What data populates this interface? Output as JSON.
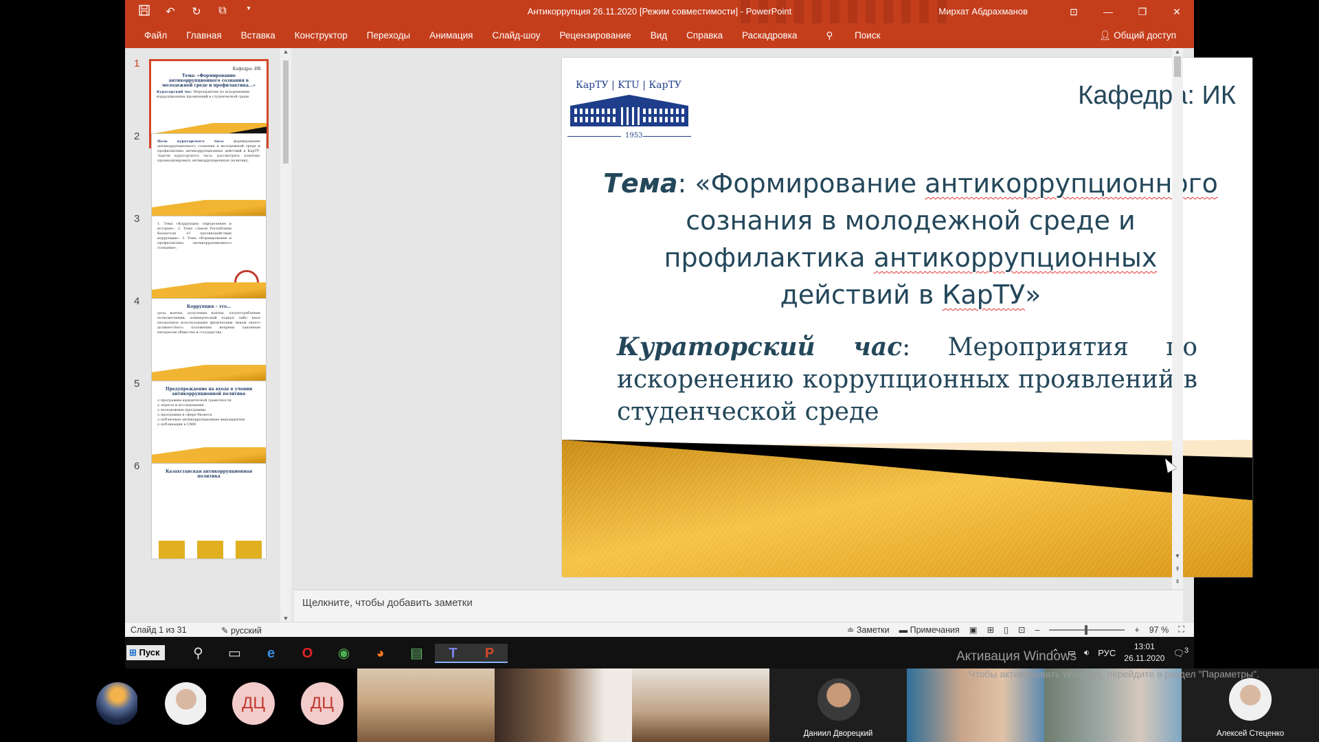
{
  "window": {
    "title": "Антикоррупция 26.11.2020 [Режим совместимости]  -  PowerPoint",
    "user": "Мирхат Абдрахманов"
  },
  "ribbon": {
    "tabs": [
      "Файл",
      "Главная",
      "Вставка",
      "Конструктор",
      "Переходы",
      "Анимация",
      "Слайд-шоу",
      "Рецензирование",
      "Вид",
      "Справка",
      "Раскадровка"
    ],
    "search": "Поиск",
    "share": "Общий доступ"
  },
  "thumbnails": {
    "numbers": [
      "1",
      "2",
      "3",
      "4",
      "5",
      "6"
    ],
    "t1_kaf": "Кафедра: ИК",
    "t2_title": "Цель кураторского часа:",
    "t4_title": "Коррупция – это…",
    "t5_title": "Предупреждение на входе в учении антикоррупционной политике",
    "t6_title": "Казахстанская антикоррупционная политика"
  },
  "slide": {
    "logo_text": "КарТУ | KTU | КарТУ",
    "logo_year": "1953",
    "kafedra": "Кафедра: ИК",
    "tema_label": "Тема",
    "tema_text_1": ": «Формирование ",
    "tema_word_1": "антикоррупционного",
    "tema_text_2": " сознания в молодежной среде и профилактика ",
    "tema_word_2": "антикоррупционных",
    "tema_text_3": " действий в ",
    "tema_word_3": "КарТУ",
    "tema_text_4": "»",
    "kur_label": "Кураторский час",
    "kur_text": ":  Мероприятия по искоренению коррупционных проявлений в студенческой среде"
  },
  "notes": {
    "placeholder": "Щелкните, чтобы добавить заметки"
  },
  "status": {
    "slide_info": "Слайд 1 из 31",
    "language": "русский",
    "notes_btn": "Заметки",
    "comments_btn": "Примечания",
    "zoom": "97 %"
  },
  "taskbar": {
    "start": "Пуск",
    "lang": "РУС",
    "time": "13:01",
    "date": "26.11.2020",
    "notif_count": "3",
    "activation": "Активация Windows",
    "activation_sub": "Чтобы активировать Windows, перейдите в раздел \"Параметры\"."
  },
  "participants": [
    {
      "initials": "",
      "name": ""
    },
    {
      "initials": "",
      "name": ""
    },
    {
      "initials": "ДЦ",
      "name": ""
    },
    {
      "initials": "ДЦ",
      "name": ""
    },
    {
      "initials": "",
      "name": ""
    },
    {
      "initials": "",
      "name": ""
    },
    {
      "initials": "",
      "name": ""
    },
    {
      "initials": "",
      "name": "Даниил Дворецкий"
    },
    {
      "initials": "",
      "name": ""
    },
    {
      "initials": "",
      "name": ""
    },
    {
      "initials": "",
      "name": "Алексей Стеценко"
    }
  ],
  "colors": {
    "accent": "#c43e1c",
    "slide_text": "#24475a",
    "gold": "#f2b533"
  }
}
